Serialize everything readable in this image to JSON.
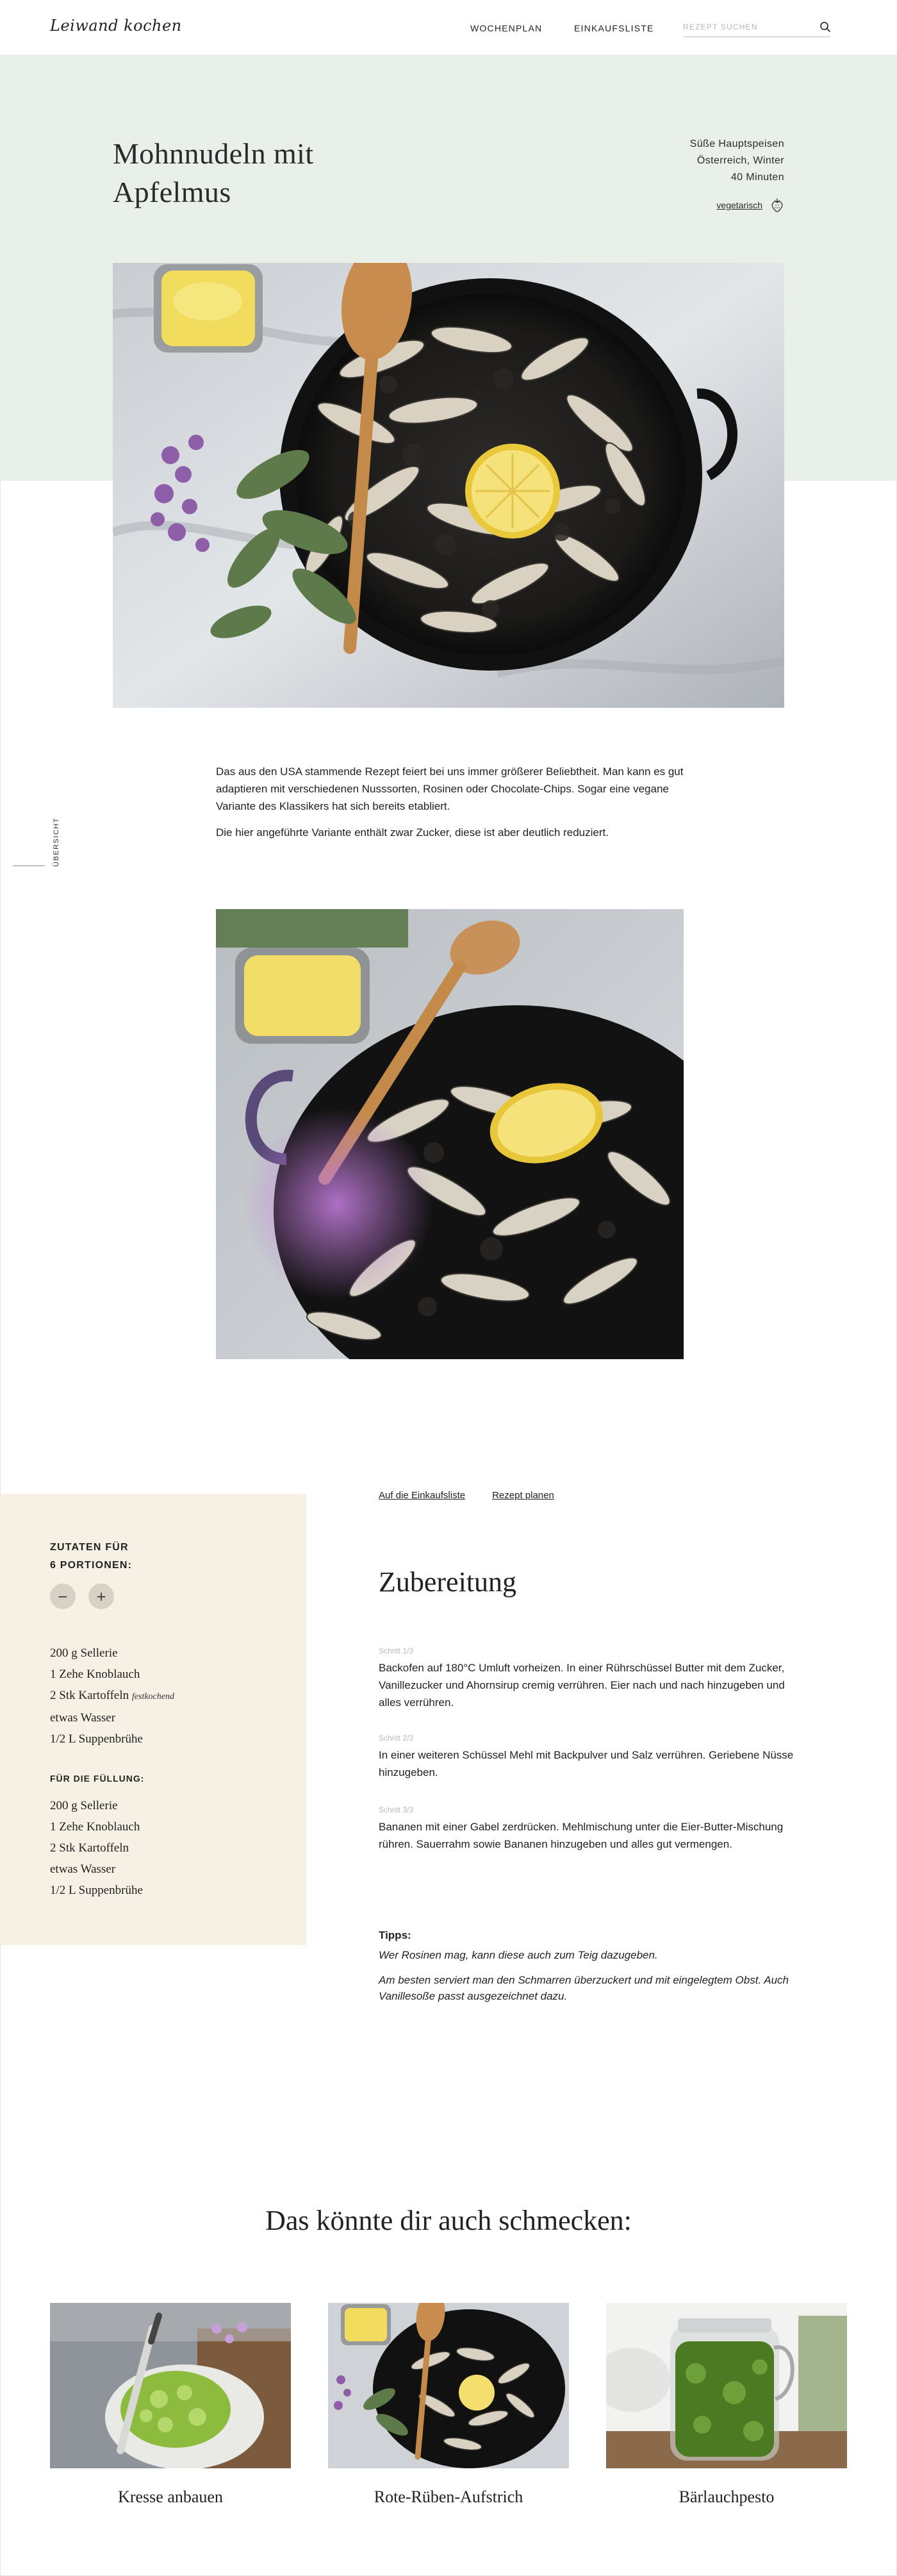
{
  "header": {
    "logo": "Leiwand kochen",
    "nav": [
      {
        "label": "WOCHENPLAN"
      },
      {
        "label": "EINKAUFSLISTE"
      }
    ],
    "search_placeholder": "REZEPT SUCHEN",
    "search_icon": "search-icon"
  },
  "recipe": {
    "title": "Mohnnudeln mit Apfelmus",
    "meta": [
      "Süße Hauptspeisen",
      "Österreich, Winter",
      "40 Minuten"
    ],
    "tag": "vegetarisch",
    "tag_icon": "strawberry-icon"
  },
  "intro": [
    "Das aus den USA stammende Rezept feiert bei uns immer größerer Beliebtheit. Man kann es gut adaptieren mit verschiedenen Nusssorten, Rosinen oder Chocolate-Chips. Sogar eine vegane Variante des Klassikers hat sich bereits etabliert.",
    "Die hier angeführte Variante enthält zwar Zucker, diese ist aber deutlich reduziert."
  ],
  "side_toggle": "ÜBERSICHT",
  "ingredients": {
    "heading_line1": "ZUTATEN FÜR",
    "heading_line2": "6 PORTIONEN:",
    "servings": 6,
    "minus_label": "−",
    "plus_label": "+",
    "items": [
      {
        "text": "200 g Sellerie",
        "note": ""
      },
      {
        "text": "1 Zehe Knoblauch",
        "note": ""
      },
      {
        "text": "2 Stk Kartoffeln",
        "note": "festkochend"
      },
      {
        "text": "etwas Wasser",
        "note": ""
      },
      {
        "text": "1/2 L Suppenbrühe",
        "note": ""
      }
    ],
    "filling_heading": "FÜR DIE FÜLLUNG:",
    "filling_items": [
      "200 g Sellerie",
      "1 Zehe Knoblauch",
      "2 Stk Kartoffeln",
      "etwas Wasser",
      "1/2 L Suppenbrühe"
    ]
  },
  "preparation": {
    "actions": [
      {
        "label": "Auf die Einkaufsliste"
      },
      {
        "label": "Rezept planen"
      }
    ],
    "title": "Zubereitung",
    "steps": [
      {
        "label": "Schritt 1/3",
        "text": "Backofen auf 180°C Umluft vorheizen. In einer Rührschüssel Butter mit dem Zucker, Vanillezucker und Ahornsirup cremig verrühren. Eier nach und nach hinzugeben und alles verrühren."
      },
      {
        "label": "Schritt 2/3",
        "text": "In einer weiteren Schüssel Mehl mit Backpulver und Salz verrühren. Geriebene Nüsse hinzugeben."
      },
      {
        "label": "Schritt 3/3",
        "text": "Bananen mit einer Gabel zerdrücken. Mehlmischung unter die Eier-Butter-Mischung rühren. Sauerrahm sowie Bananen hinzugeben und alles gut vermengen."
      }
    ],
    "tips_heading": "Tipps:",
    "tips": [
      "Wer Rosinen mag, kann diese auch zum Teig dazugeben.",
      "Am besten serviert man den Schmarren überzuckert und mit eingelegtem Obst. Auch Vanillesoße passt ausgezeichnet dazu."
    ]
  },
  "related": {
    "title": "Das könnte dir auch schmecken:",
    "cards": [
      {
        "label": "Kresse anbauen"
      },
      {
        "label": "Rote-Rüben-Aufstrich"
      },
      {
        "label": "Bärlauchpesto"
      }
    ]
  },
  "colors": {
    "hero_bg": "#e9efe9",
    "ingredients_bg": "#f6f0e5",
    "step_label": "#b8b8b8"
  }
}
